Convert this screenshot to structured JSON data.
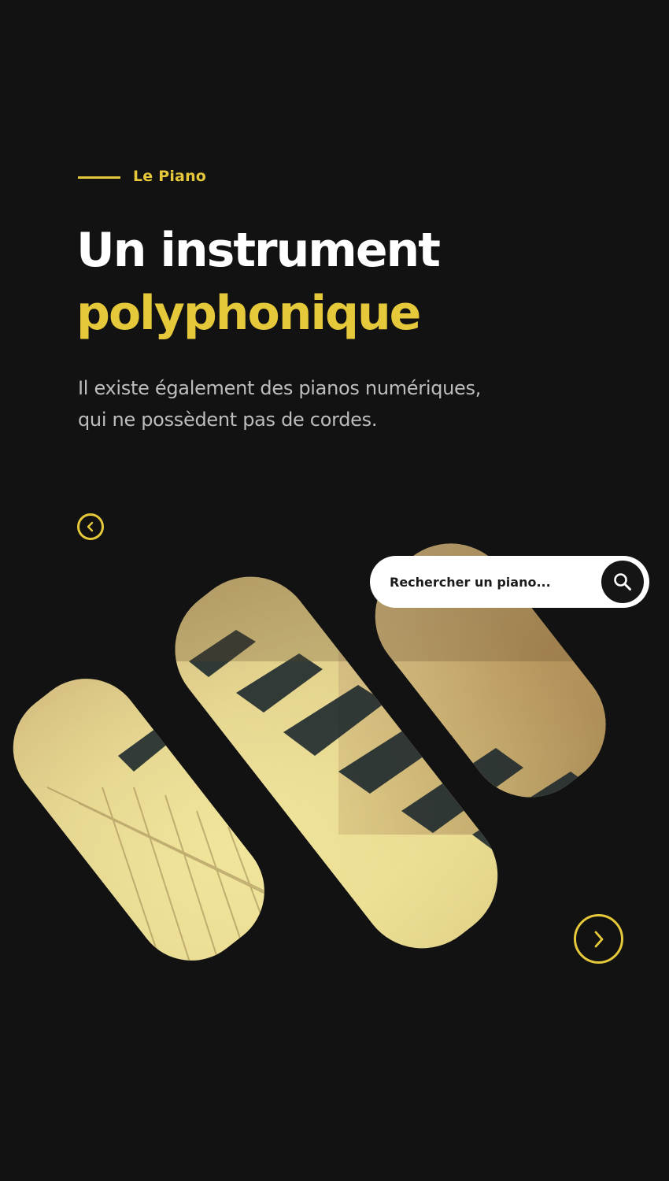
{
  "header": {
    "eyebrow": "Le Piano",
    "title_line1": "Un instrument",
    "title_line2": "polyphonique",
    "subtitle_line1": "Il existe également des pianos numériques,",
    "subtitle_line2": "qui ne possèdent pas de cordes."
  },
  "search": {
    "placeholder": "Rechercher un piano..."
  },
  "colors": {
    "background": "#121212",
    "accent": "#e6c93a",
    "text": "#ffffff",
    "muted": "#bdbdbd"
  },
  "icons": {
    "prev": "chevron-left-icon",
    "next": "chevron-right-icon",
    "search": "search-icon"
  }
}
